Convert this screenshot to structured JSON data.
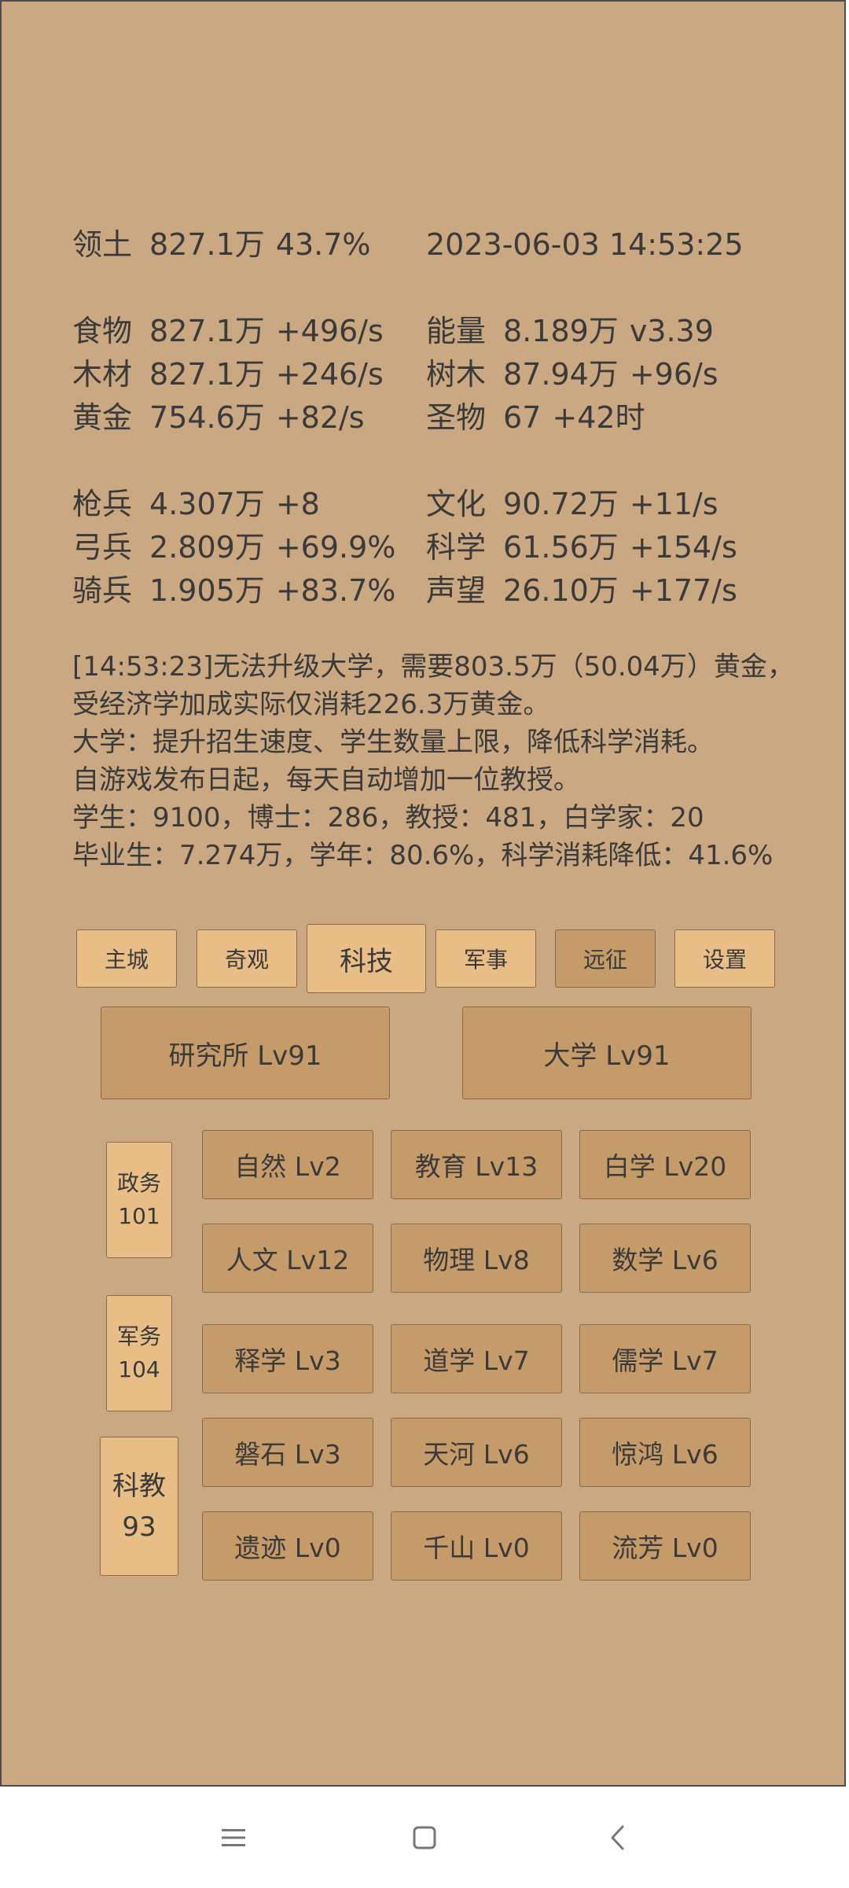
{
  "header": {
    "territory_label": "领土",
    "territory_value": "827.1万",
    "territory_percent": "43.7%",
    "datetime": "2023-06-03 14:53:25"
  },
  "resources_left": [
    {
      "label": "食物",
      "value": "827.1万",
      "rate": "+496/s"
    },
    {
      "label": "木材",
      "value": "827.1万",
      "rate": "+246/s"
    },
    {
      "label": "黄金",
      "value": "754.6万",
      "rate": "+82/s"
    }
  ],
  "resources_right": [
    {
      "label": "能量",
      "value": "8.189万",
      "rate": "v3.39"
    },
    {
      "label": "树木",
      "value": "87.94万",
      "rate": "+96/s"
    },
    {
      "label": "圣物",
      "value": "67",
      "rate": "+42时"
    }
  ],
  "military_left": [
    {
      "label": "枪兵",
      "value": "4.307万",
      "rate": "+8"
    },
    {
      "label": "弓兵",
      "value": "2.809万",
      "rate": "+69.9%"
    },
    {
      "label": "骑兵",
      "value": "1.905万",
      "rate": "+83.7%"
    }
  ],
  "stats_right": [
    {
      "label": "文化",
      "value": "90.72万",
      "rate": "+11/s"
    },
    {
      "label": "科学",
      "value": "61.56万",
      "rate": "+154/s"
    },
    {
      "label": "声望",
      "value": "26.10万",
      "rate": "+177/s"
    }
  ],
  "messages": [
    "[14:53:23]无法升级大学，需要803.5万（50.04万）黄金，",
    "受经济学加成实际仅消耗226.3万黄金。",
    "大学：提升招生速度、学生数量上限，降低科学消耗。",
    "自游戏发布日起，每天自动增加一位教授。",
    "学生：9100，博士：286，教授：481，白学家：20",
    "毕业生：7.274万，学年：80.6%，科学消耗降低：41.6%"
  ],
  "tabs": [
    {
      "label": "主城"
    },
    {
      "label": "奇观"
    },
    {
      "label": "科技"
    },
    {
      "label": "军事"
    },
    {
      "label": "远征"
    },
    {
      "label": "设置"
    }
  ],
  "main_buildings": [
    {
      "label": "研究所 Lv91"
    },
    {
      "label": "大学 Lv91"
    }
  ],
  "side_buttons": [
    {
      "name": "政务",
      "value": "101"
    },
    {
      "name": "军务",
      "value": "104"
    },
    {
      "name": "科教",
      "value": "93"
    }
  ],
  "tech_grid": [
    [
      "自然 Lv2",
      "教育 Lv13",
      "白学 Lv20"
    ],
    [
      "人文 Lv12",
      "物理 Lv8",
      "数学 Lv6"
    ],
    [
      "释学 Lv3",
      "道学 Lv7",
      "儒学 Lv7"
    ],
    [
      "磐石 Lv3",
      "天河 Lv6",
      "惊鸿 Lv6"
    ],
    [
      "遗迹 Lv0",
      "千山 Lv0",
      "流芳 Lv0"
    ]
  ],
  "colors": {
    "panel_bg": "#c9a882",
    "button_light": "#e8bd86",
    "button_dark": "#c69b6a",
    "text": "#3a3a3a"
  },
  "navigation": {
    "icons": [
      "menu-icon",
      "home-square-icon",
      "back-chevron-icon"
    ]
  }
}
